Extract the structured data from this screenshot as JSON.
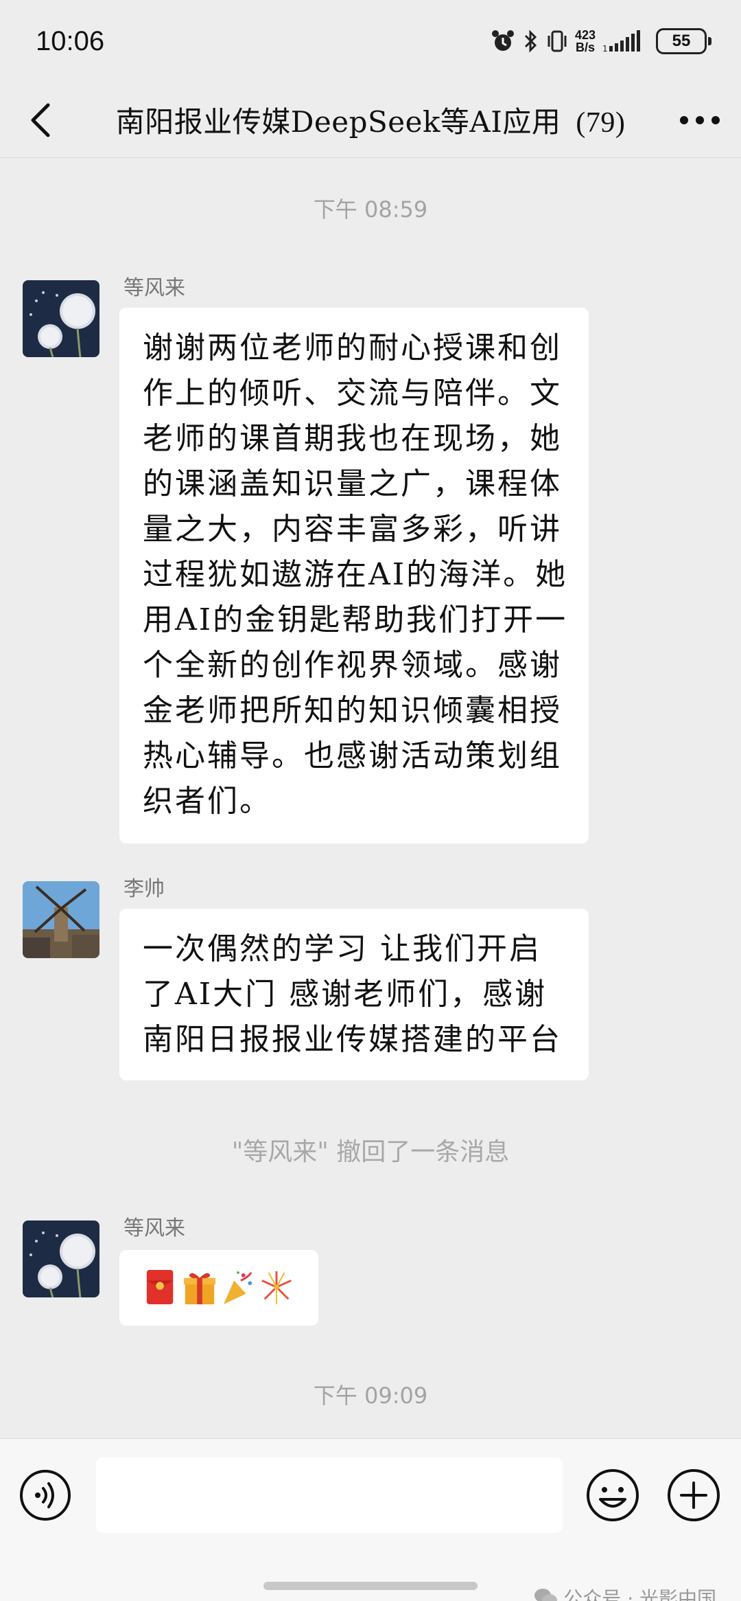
{
  "status_bar": {
    "time": "10:06",
    "net_speed_value": "423",
    "net_speed_unit": "B/s",
    "battery": "55"
  },
  "header": {
    "title": "南阳报业传媒DeepSeek等AI应用",
    "member_count": "(79)"
  },
  "messages": [
    {
      "type": "timestamp",
      "text": "下午 08:59"
    },
    {
      "type": "message",
      "sender": "等风来",
      "avatar": "dandelion-avatar",
      "lines": [
        "谢谢两位老师的耐心授课和创",
        "作上的倾听、交流与陪伴。文",
        "老师的课首期我也在现场，她",
        "的课涵盖知识量之广，课程体",
        "量之大，内容丰富多彩，听讲",
        "过程犹如遨游在AI的海洋。她",
        "用AI的金钥匙帮助我们打开一",
        "个全新的创作视界领域。感谢",
        "金老师把所知的知识倾囊相授",
        "热心辅导。也感谢活动策划组",
        "织者们。"
      ]
    },
    {
      "type": "message",
      "sender": "李帅",
      "avatar": "windmill-avatar",
      "lines": [
        "一次偶然的学习 让我们开启",
        "了AI大门  感谢老师们，感谢",
        "南阳日报报业传媒搭建的平台"
      ]
    },
    {
      "type": "system",
      "text": "\"等风来\" 撤回了一条消息"
    },
    {
      "type": "message",
      "sender": "等风来",
      "avatar": "dandelion-avatar",
      "emojis": [
        "red-envelope-icon",
        "gift-icon",
        "party-popper-icon",
        "fireworks-icon"
      ]
    },
    {
      "type": "timestamp",
      "text": "下午 09:09"
    }
  ],
  "watermark": "公众号 · 光影中国",
  "colors": {
    "background": "#ededed",
    "bubble": "#ffffff",
    "timestamp": "#a3a3a3",
    "sender": "#777777"
  }
}
